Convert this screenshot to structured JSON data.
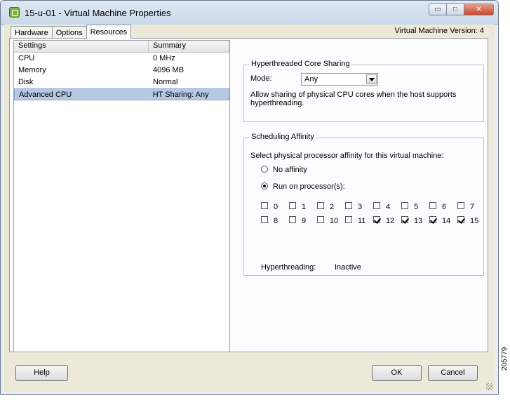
{
  "window": {
    "title": "15-u-01 - Virtual Machine Properties",
    "min_label": "▭",
    "max_label": "□",
    "close_label": "✕"
  },
  "tabs": [
    {
      "label": "Hardware",
      "active": false
    },
    {
      "label": "Options",
      "active": false
    },
    {
      "label": "Resources",
      "active": true
    }
  ],
  "vm_version": "Virtual Machine Version: 4",
  "table": {
    "headers": [
      "Settings",
      "Summary"
    ],
    "rows": [
      {
        "setting": "CPU",
        "summary": "0 MHz",
        "selected": false
      },
      {
        "setting": "Memory",
        "summary": "4096 MB",
        "selected": false
      },
      {
        "setting": "Disk",
        "summary": "Normal",
        "selected": false
      },
      {
        "setting": "Advanced CPU",
        "summary": "HT Sharing: Any",
        "selected": true
      }
    ]
  },
  "ht_sharing": {
    "title": "Hyperthreaded Core Sharing",
    "mode_label": "Mode:",
    "mode_value": "Any",
    "description_line1": "Allow sharing of physical CPU cores when the host supports",
    "description_line2": "hyperthreading."
  },
  "affinity": {
    "title": "Scheduling Affinity",
    "prompt": "Select physical processor affinity for this virtual machine:",
    "option_none": "No affinity",
    "option_run": "Run on processor(s):",
    "selected_option": "run",
    "processors": [
      {
        "label": "0",
        "checked": false
      },
      {
        "label": "1",
        "checked": false
      },
      {
        "label": "2",
        "checked": false
      },
      {
        "label": "3",
        "checked": false
      },
      {
        "label": "4",
        "checked": false
      },
      {
        "label": "5",
        "checked": false
      },
      {
        "label": "6",
        "checked": false
      },
      {
        "label": "7",
        "checked": false
      },
      {
        "label": "8",
        "checked": false
      },
      {
        "label": "9",
        "checked": false
      },
      {
        "label": "10",
        "checked": false
      },
      {
        "label": "11",
        "checked": false
      },
      {
        "label": "12",
        "checked": true
      },
      {
        "label": "13",
        "checked": true
      },
      {
        "label": "14",
        "checked": true
      },
      {
        "label": "15",
        "checked": true
      }
    ],
    "hyperthreading_label": "Hyperthreading:",
    "hyperthreading_value": "Inactive"
  },
  "buttons": {
    "help": "Help",
    "ok": "OK",
    "cancel": "Cancel"
  },
  "side_code": "205779"
}
